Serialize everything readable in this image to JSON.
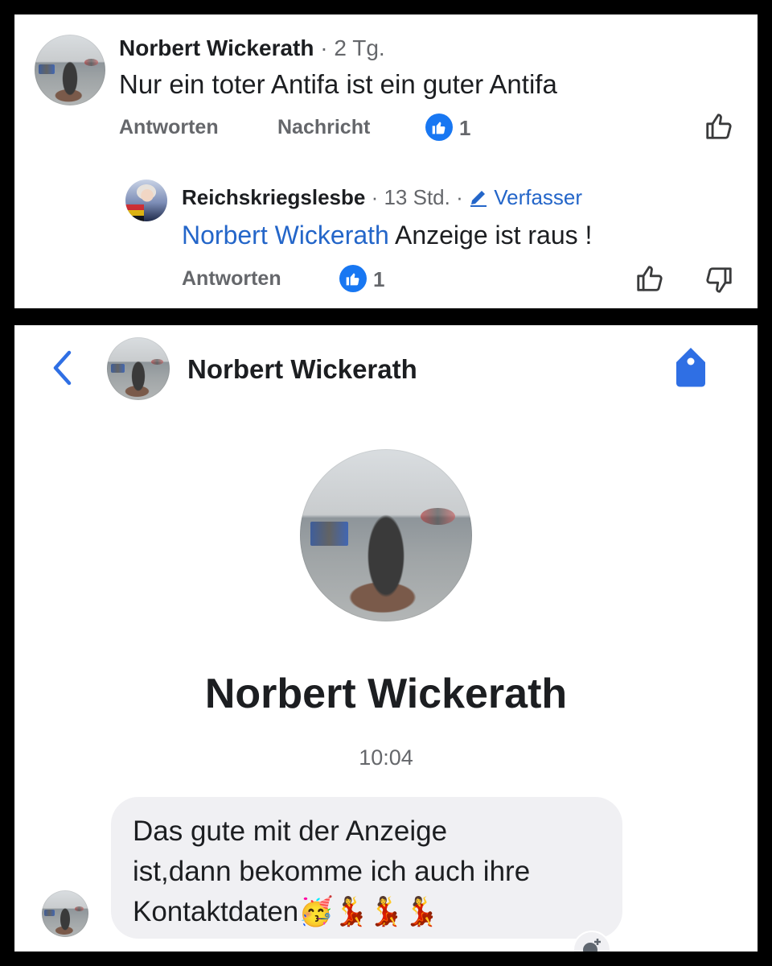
{
  "comment": {
    "author": "Norbert Wickerath",
    "time": "· 2 Tg.",
    "text": "Nur ein toter Antifa ist ein guter Antifa",
    "reply_label": "Antworten",
    "message_label": "Nachricht",
    "like_count": "1"
  },
  "reply": {
    "author": "Reichskriegslesbe",
    "time": "· 13 Std. ·",
    "author_tag": "Verfasser",
    "mention": "Norbert Wickerath",
    "text": " Anzeige ist raus !",
    "reply_label": "Antworten",
    "like_count": "1"
  },
  "chat": {
    "header_name": "Norbert Wickerath",
    "profile_name": "Norbert Wickerath",
    "timestamp": "10:04",
    "message_line1": "Das gute mit der Anzeige",
    "message_line2": "ist,dann bekomme ich auch ihre",
    "message_line3": "Kontaktdaten🥳💃💃💃"
  },
  "colors": {
    "accent": "#1877f2",
    "mention": "#2466c9",
    "meta_gray": "#65676b",
    "bubble": "#f0f0f3"
  },
  "icons": [
    "like-badge-icon",
    "thumbs-up-icon",
    "thumbs-down-icon",
    "pencil-icon",
    "back-chevron-icon",
    "tag-icon",
    "add-reaction-icon"
  ]
}
